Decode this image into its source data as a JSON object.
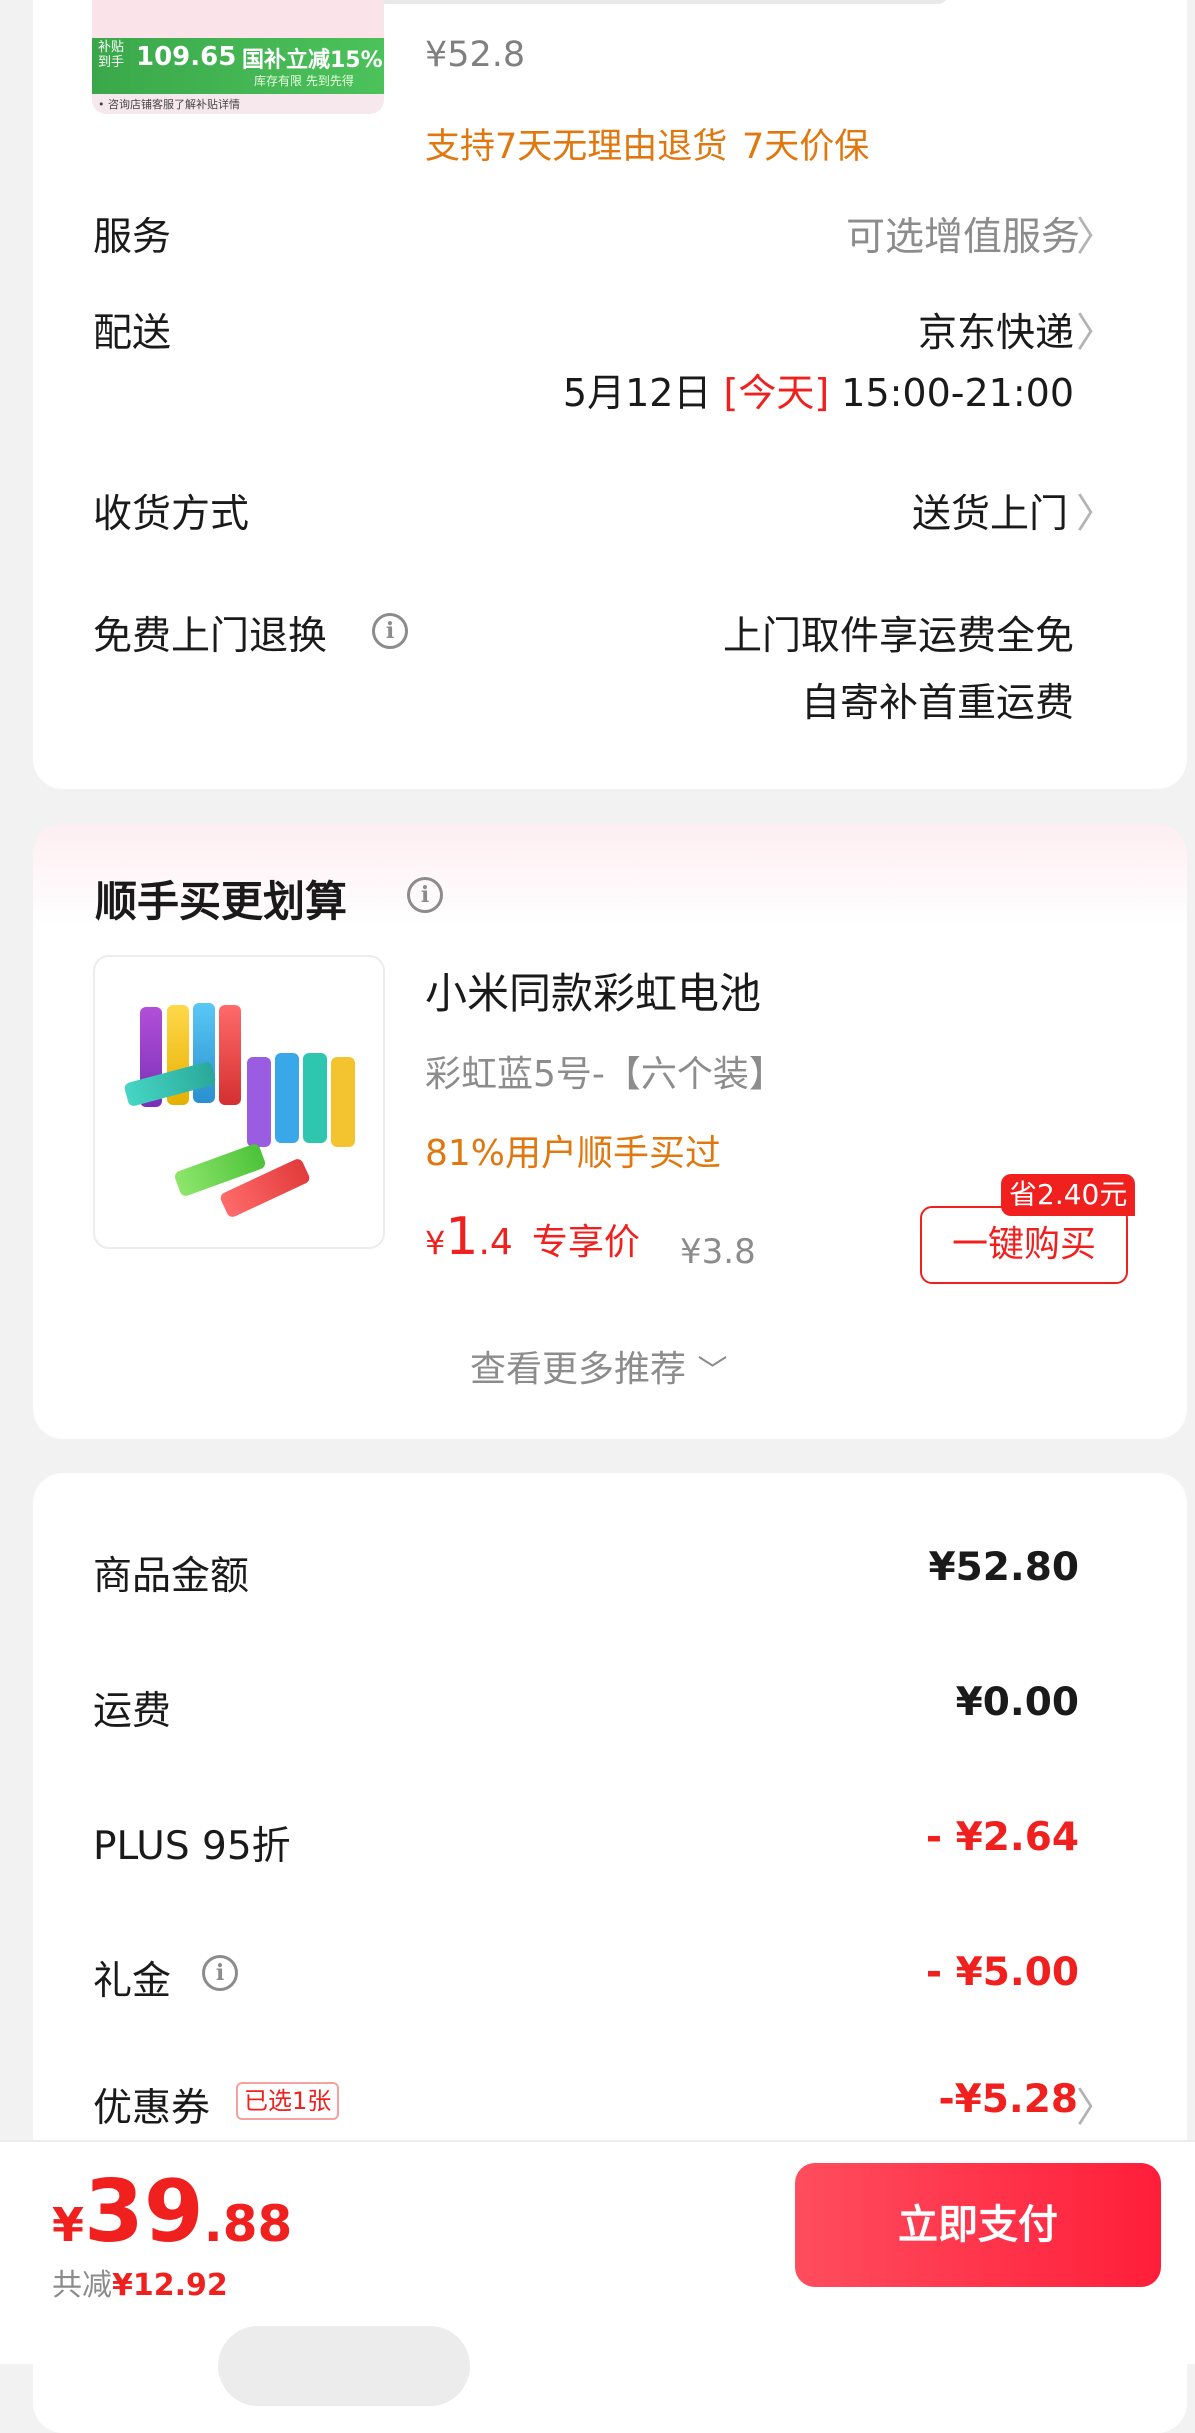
{
  "top_product": {
    "banner": {
      "subsidy_label": "补贴\n到手",
      "subsidy_price": "109.65",
      "gov_label": "国补立减15%",
      "gov_sub": "库存有限 先到先得",
      "note": "• 咨询店铺客服了解补贴详情"
    },
    "price": "¥52.8",
    "return_policy": "支持7天无理由退货",
    "price_protect": "7天价保"
  },
  "rows": {
    "service": {
      "label": "服务",
      "value": "可选增值服务"
    },
    "delivery": {
      "label": "配送",
      "value": "京东快递",
      "date": "5月12日",
      "today": "[今天]",
      "time": "15:00-21:00"
    },
    "receive": {
      "label": "收货方式",
      "value": "送货上门"
    },
    "free_return": {
      "label": "免费上门退换",
      "value_1": "上门取件享运费全免",
      "value_2": "自寄补首重运费"
    }
  },
  "addon": {
    "title": "顺手买更划算",
    "product_name": "小米同款彩虹电池",
    "spec": "彩虹蓝5号-【六个装】",
    "bought": "81%用户顺手买过",
    "currency": "¥",
    "price_int": "1",
    "price_dec": ".4",
    "price_tag": "专享价",
    "orig_price": "¥3.8",
    "save_badge": "省2.40元",
    "buy_btn": "一键购买",
    "more": "查看更多推荐"
  },
  "summary": {
    "items_label": "商品金额",
    "items_value": "¥52.80",
    "freight_label": "运费",
    "freight_value": "¥0.00",
    "plus_label": "PLUS 95折",
    "plus_value": "- ¥2.64",
    "gift_label": "礼金",
    "gift_value": "- ¥5.00",
    "coupon_label": "优惠券",
    "coupon_badge": "已选1张",
    "coupon_value": "-¥5.28"
  },
  "bottom": {
    "currency": "¥",
    "total_int": "39",
    "total_dec": ".88",
    "saved_label": "共减",
    "saved_value": "¥12.92",
    "pay_btn": "立即支付"
  },
  "colors": {
    "accent_red": "#f0201e",
    "orange": "#e0780f",
    "pay_gradient_end": "#ff1e3a"
  }
}
